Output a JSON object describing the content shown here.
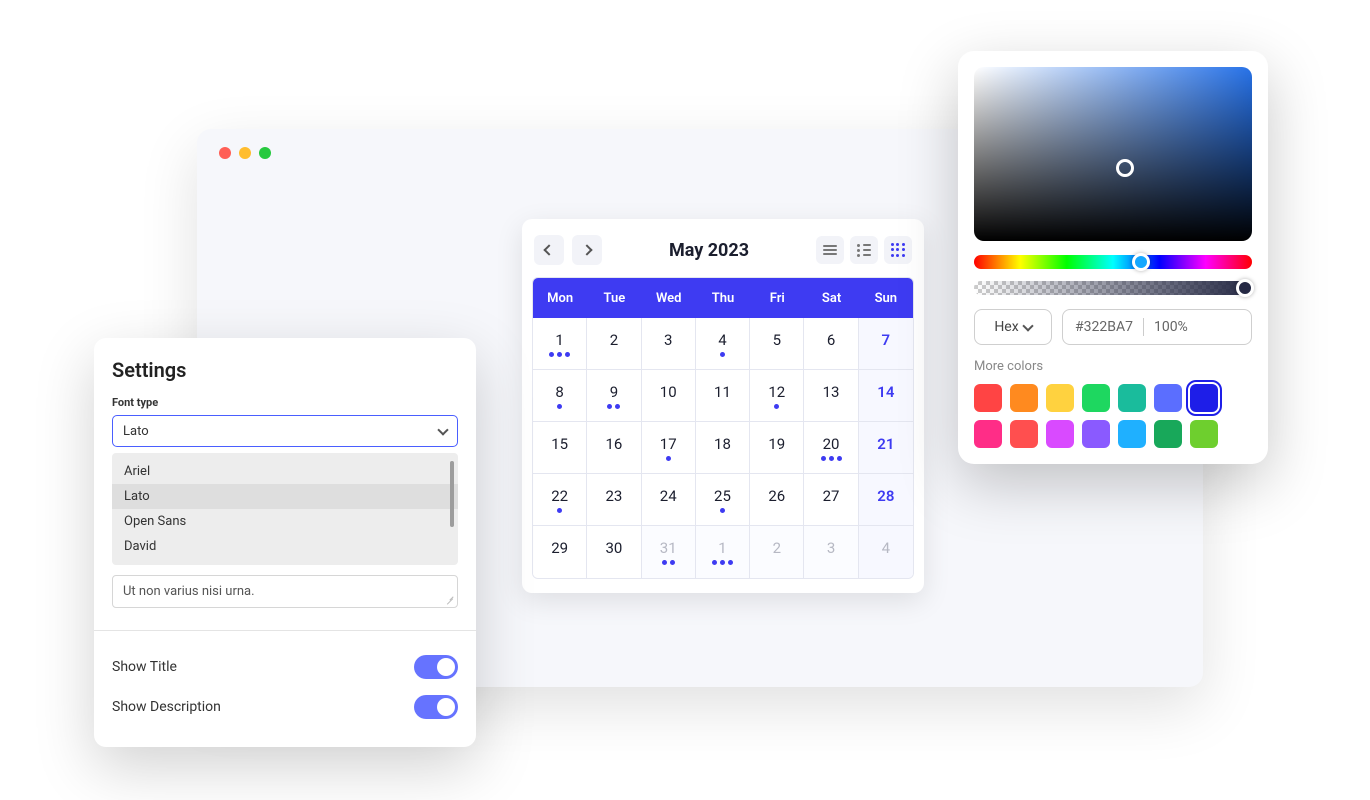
{
  "settings": {
    "title": "Settings",
    "font_type_label": "Font type",
    "font_selected": "Lato",
    "font_options": [
      "Ariel",
      "Lato",
      "Open Sans",
      "David"
    ],
    "textarea_value": "Ut non varius nisi urna.",
    "show_title_label": "Show Title",
    "show_description_label": "Show Description"
  },
  "calendar": {
    "title": "May 2023",
    "weekdays": [
      "Mon",
      "Tue",
      "Wed",
      "Thu",
      "Fri",
      "Sat",
      "Sun"
    ],
    "weeks": [
      [
        {
          "n": "1",
          "dots": 3
        },
        {
          "n": "2"
        },
        {
          "n": "3"
        },
        {
          "n": "4",
          "dots": 1
        },
        {
          "n": "5"
        },
        {
          "n": "6"
        },
        {
          "n": "7",
          "sun": true
        }
      ],
      [
        {
          "n": "8",
          "dots": 1
        },
        {
          "n": "9",
          "dots": 2
        },
        {
          "n": "10"
        },
        {
          "n": "11"
        },
        {
          "n": "12",
          "dots": 1
        },
        {
          "n": "13"
        },
        {
          "n": "14",
          "sun": true
        }
      ],
      [
        {
          "n": "15"
        },
        {
          "n": "16"
        },
        {
          "n": "17",
          "dots": 1
        },
        {
          "n": "18"
        },
        {
          "n": "19"
        },
        {
          "n": "20",
          "dots": 3
        },
        {
          "n": "21",
          "sun": true
        }
      ],
      [
        {
          "n": "22",
          "dots": 1
        },
        {
          "n": "23"
        },
        {
          "n": "24"
        },
        {
          "n": "25",
          "dots": 1
        },
        {
          "n": "26"
        },
        {
          "n": "27"
        },
        {
          "n": "28",
          "sun": true
        }
      ],
      [
        {
          "n": "29"
        },
        {
          "n": "30"
        },
        {
          "n": "31",
          "muted": true,
          "dots": 2
        },
        {
          "n": "1",
          "muted": true,
          "dots": 3
        },
        {
          "n": "2",
          "muted": true
        },
        {
          "n": "3",
          "muted": true
        },
        {
          "n": "4",
          "muted": true
        }
      ]
    ]
  },
  "colorpicker": {
    "format_label": "Hex",
    "hex_value": "#322BA7",
    "alpha_value": "100%",
    "more_label": "More colors",
    "swatches": [
      {
        "c": "#ff4444"
      },
      {
        "c": "#ff8a1f"
      },
      {
        "c": "#ffd23f"
      },
      {
        "c": "#1ed760"
      },
      {
        "c": "#1abc9c"
      },
      {
        "c": "#5b6eff"
      },
      {
        "c": "#1e1ee8",
        "selected": true
      },
      {
        "c": "#ffffff",
        "hidden": true
      },
      {
        "c": "#ff2d87"
      },
      {
        "c": "#ff4f4f"
      },
      {
        "c": "#d94aff"
      },
      {
        "c": "#8a5aff"
      },
      {
        "c": "#1fb0ff"
      },
      {
        "c": "#18a85a"
      },
      {
        "c": "#6ecf2e"
      }
    ]
  }
}
